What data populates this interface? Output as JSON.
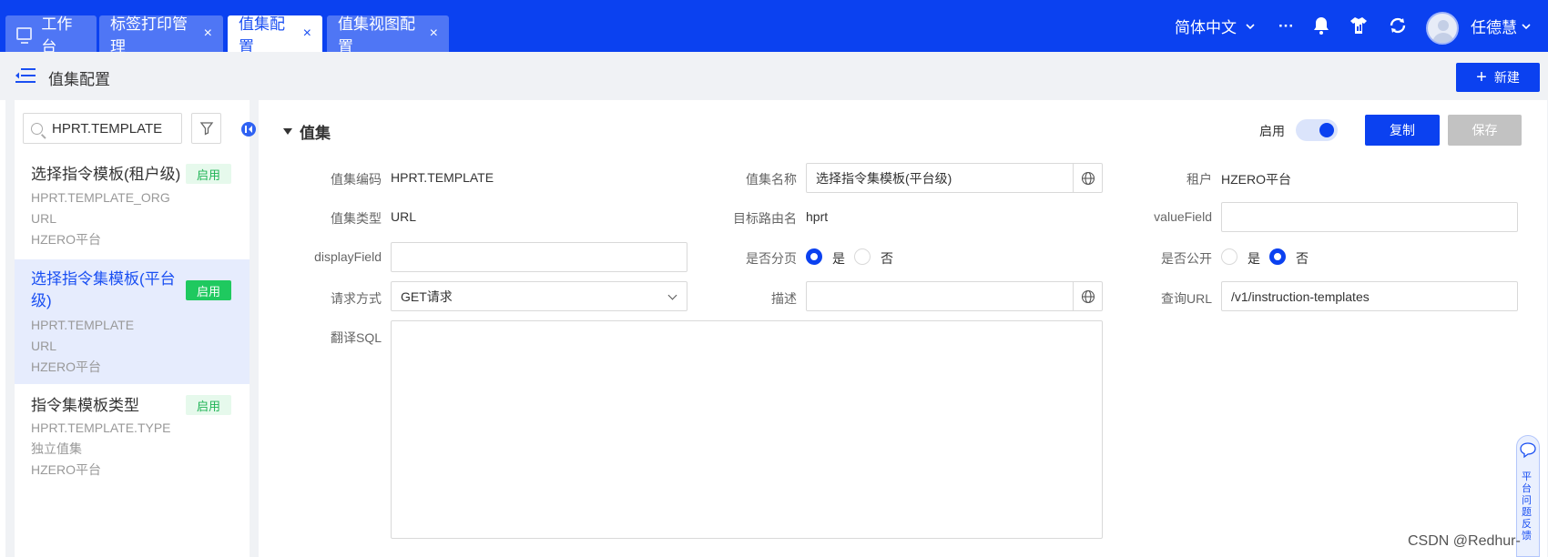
{
  "tabs": [
    {
      "label": "工作台"
    },
    {
      "label": "标签打印管理",
      "close": "×"
    },
    {
      "label": "值集配置",
      "close": "×"
    },
    {
      "label": "值集视图配置",
      "close": "×"
    }
  ],
  "topbar": {
    "language": "简体中文",
    "more": "···",
    "username": "任德慧",
    "accent": "#0b41f0"
  },
  "page": {
    "title": "值集配置",
    "new_button": "新建",
    "new_button_icon": "+"
  },
  "sidebar": {
    "search_value": "HPRT.TEMPLATE",
    "items": [
      {
        "title": "选择指令模板(租户级)",
        "code": "HPRT.TEMPLATE_ORG",
        "type": "URL",
        "tenant": "HZERO平台",
        "status": "启用"
      },
      {
        "title": "选择指令集模板(平台级)",
        "code": "HPRT.TEMPLATE",
        "type": "URL",
        "tenant": "HZERO平台",
        "status": "启用"
      },
      {
        "title": "指令集模板类型",
        "code": "HPRT.TEMPLATE.TYPE",
        "type": "独立值集",
        "tenant": "HZERO平台",
        "status": "启用"
      }
    ]
  },
  "main": {
    "section_title": "值集",
    "enable_label": "启用",
    "enabled": true,
    "copy_button": "复制",
    "save_button": "保存",
    "fields": {
      "code_label": "值集编码",
      "code_value": "HPRT.TEMPLATE",
      "name_label": "值集名称",
      "name_value": "选择指令集模板(平台级)",
      "tenant_label": "租户",
      "tenant_value": "HZERO平台",
      "type_label": "值集类型",
      "type_value": "URL",
      "route_label": "目标路由名",
      "route_value": "hprt",
      "valuefield_label": "valueField",
      "valuefield_value": "",
      "displayfield_label": "displayField",
      "displayfield_value": "",
      "paging_label": "是否分页",
      "paging_yes": "是",
      "paging_no": "否",
      "paging_selected": "是",
      "public_label": "是否公开",
      "public_yes": "是",
      "public_no": "否",
      "public_selected": "否",
      "method_label": "请求方式",
      "method_value": "GET请求",
      "desc_label": "描述",
      "desc_value": "",
      "url_label": "查询URL",
      "url_value": "/v1/instruction-templates",
      "sql_label": "翻译SQL",
      "sql_value": ""
    }
  },
  "feedback": {
    "label": "平台问题反馈"
  },
  "watermark": "CSDN @Redhur-"
}
